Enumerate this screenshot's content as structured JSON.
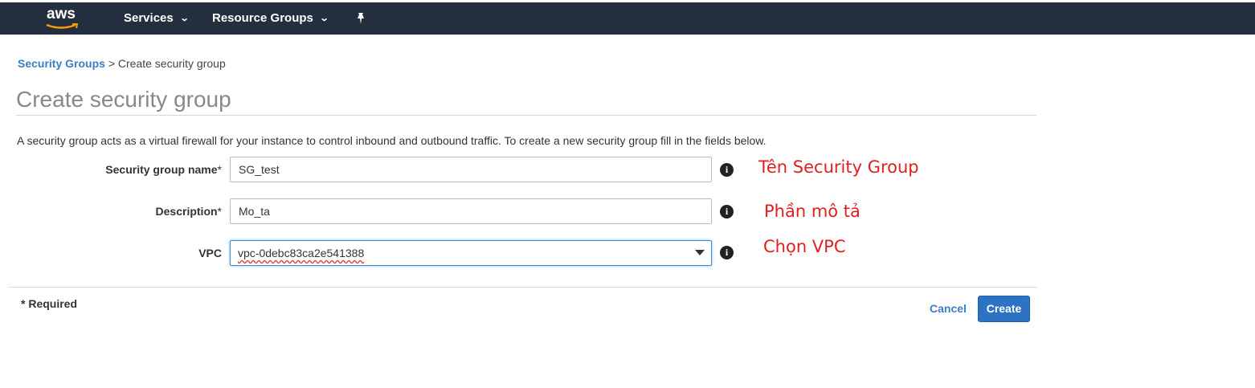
{
  "topbar": {
    "logo_text": "aws",
    "nav": [
      "Services",
      "Resource Groups"
    ],
    "chevron": "⌄",
    "pin_icon": "pin-icon"
  },
  "breadcrumb": {
    "parent": "Security Groups",
    "separator": ">",
    "current": "Create security group"
  },
  "page": {
    "title": "Create security group",
    "description": "A security group acts as a virtual firewall for your instance to control inbound and outbound traffic. To create a new security group fill in the fields below."
  },
  "form": {
    "name_label": "Security group name",
    "name_value": "SG_test",
    "description_label": "Description",
    "description_value": "Mo_ta",
    "vpc_label": "VPC",
    "vpc_value": "vpc-0debc83ca2e541388",
    "required_mark": "*"
  },
  "annotations": {
    "name": "Tên Security Group",
    "description": "Phần mô tả",
    "vpc": "Chọn VPC"
  },
  "footer": {
    "required_note": "* Required",
    "cancel_label": "Cancel",
    "create_label": "Create"
  },
  "colors": {
    "topbar": "#232f3e",
    "link": "#3b7ec3",
    "primary_button": "#2e73c3",
    "annotation": "#e02020"
  }
}
